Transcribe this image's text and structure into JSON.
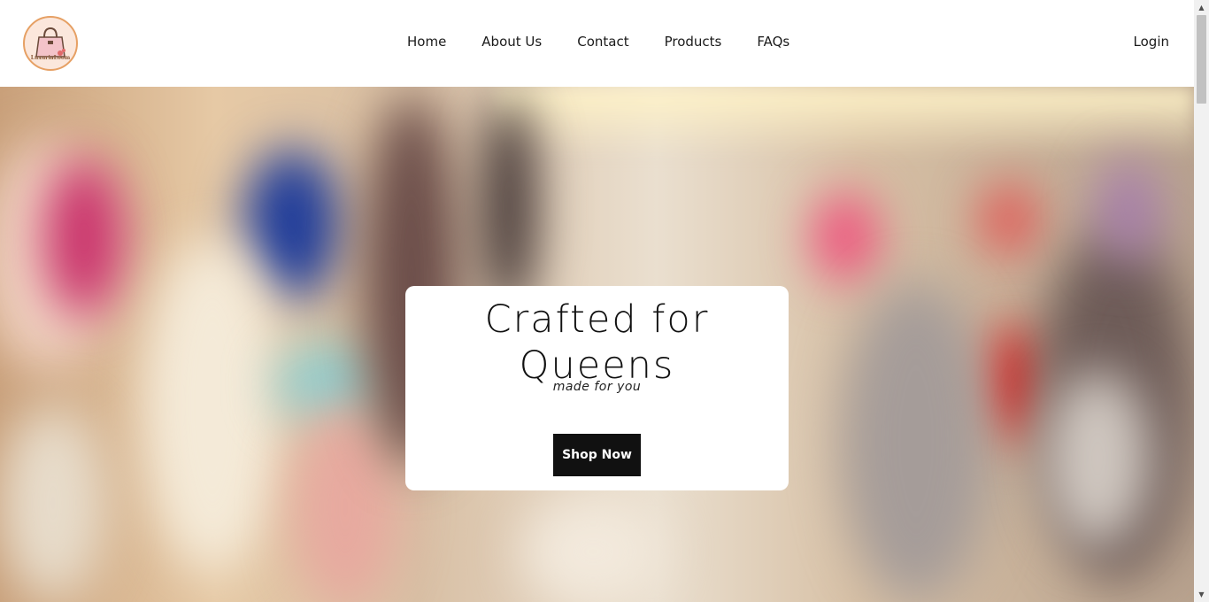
{
  "brand": {
    "logo_text": "LuxuriaLoom",
    "icon": "handbag-icon"
  },
  "nav": {
    "items": [
      {
        "label": "Home"
      },
      {
        "label": "About Us"
      },
      {
        "label": "Contact"
      },
      {
        "label": "Products"
      },
      {
        "label": "FAQs"
      }
    ],
    "login_label": "Login"
  },
  "hero": {
    "title": "Crafted for Queens",
    "subtitle": "made for you",
    "cta_label": "Shop Now"
  },
  "colors": {
    "header_bg": "#ffffff",
    "button_bg": "#111111",
    "button_text": "#ffffff",
    "text": "#1b1b1b"
  },
  "scrollbar": {
    "up_icon": "scroll-up-arrow-icon",
    "down_icon": "scroll-down-arrow-icon"
  }
}
